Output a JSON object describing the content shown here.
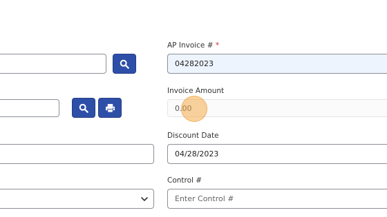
{
  "ap_invoice": {
    "label": "AP Invoice #",
    "required_mark": "*",
    "value": "04282023"
  },
  "invoice_amount": {
    "label": "Invoice Amount",
    "value": "0.00"
  },
  "discount_date": {
    "label": "Discount Date",
    "value": "04/28/2023"
  },
  "control": {
    "label": "Control #",
    "placeholder": "Enter Control #"
  },
  "colors": {
    "button_bg": "#2e4fa8",
    "required": "#c62828",
    "highlight_field": "#eef4fd",
    "cursor_marker": "#f6a63c"
  }
}
